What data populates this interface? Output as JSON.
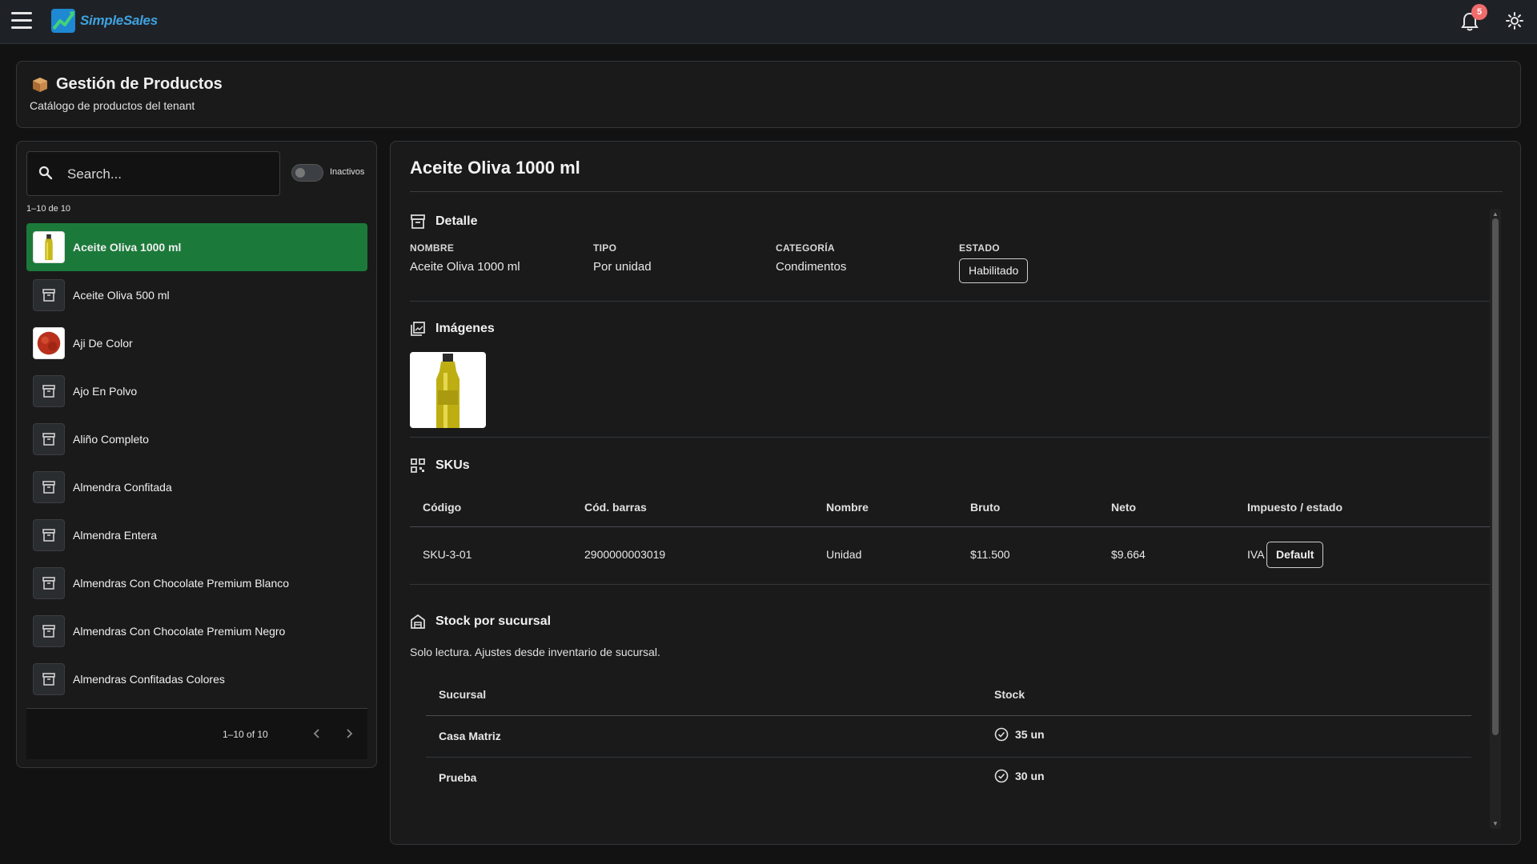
{
  "app": {
    "name": "SimpleSales",
    "notification_count": "5"
  },
  "header": {
    "title": "Gestión de Productos",
    "subtitle": "Catálogo de productos del tenant"
  },
  "sidebar": {
    "search_placeholder": "Search...",
    "toggle_label": "Inactivos",
    "range_label": "1–10 de 10",
    "items": [
      {
        "name": "Aceite Oliva 1000 ml",
        "thumb": "olive-oil-bottle",
        "selected": true
      },
      {
        "name": "Aceite Oliva 500 ml",
        "thumb": "archive-icon"
      },
      {
        "name": "Aji De Color",
        "thumb": "red-spice"
      },
      {
        "name": "Ajo En Polvo",
        "thumb": "archive-icon"
      },
      {
        "name": "Aliño Completo",
        "thumb": "archive-icon"
      },
      {
        "name": "Almendra Confitada",
        "thumb": "archive-icon"
      },
      {
        "name": "Almendra Entera",
        "thumb": "archive-icon"
      },
      {
        "name": "Almendras Con Chocolate Premium Blanco",
        "thumb": "archive-icon"
      },
      {
        "name": "Almendras Con Chocolate Premium Negro",
        "thumb": "archive-icon"
      },
      {
        "name": "Almendras Confitadas Colores",
        "thumb": "archive-icon"
      }
    ],
    "pager_text": "1–10 of 10"
  },
  "detail": {
    "title": "Aceite Oliva 1000 ml",
    "sections": {
      "detalle": "Detalle",
      "imagenes": "Imágenes",
      "skus": "SKUs",
      "stock": "Stock por sucursal"
    },
    "fields": {
      "nombre_label": "NOMBRE",
      "nombre_value": "Aceite Oliva 1000 ml",
      "tipo_label": "TIPO",
      "tipo_value": "Por unidad",
      "categoria_label": "CATEGORÍA",
      "categoria_value": "Condimentos",
      "estado_label": "ESTADO",
      "estado_value": "Habilitado"
    },
    "sku_table": {
      "headers": [
        "Código",
        "Cód. barras",
        "Nombre",
        "Bruto",
        "Neto",
        "Impuesto / estado"
      ],
      "rows": [
        {
          "codigo": "SKU-3-01",
          "barras": "2900000003019",
          "nombre": "Unidad",
          "bruto": "$11.500",
          "neto": "$9.664",
          "impuesto": "IVA",
          "estado": "Default"
        }
      ]
    },
    "stock_note": "Solo lectura. Ajustes desde inventario de sucursal.",
    "stock_table": {
      "headers": [
        "Sucursal",
        "Stock"
      ],
      "rows": [
        {
          "sucursal": "Casa Matriz",
          "stock": "35 un"
        },
        {
          "sucursal": "Prueba",
          "stock": "30 un"
        }
      ]
    }
  },
  "colors": {
    "selected": "#1b7a3a",
    "brand": "#3fa2e0",
    "badge": "#f06b6b"
  }
}
